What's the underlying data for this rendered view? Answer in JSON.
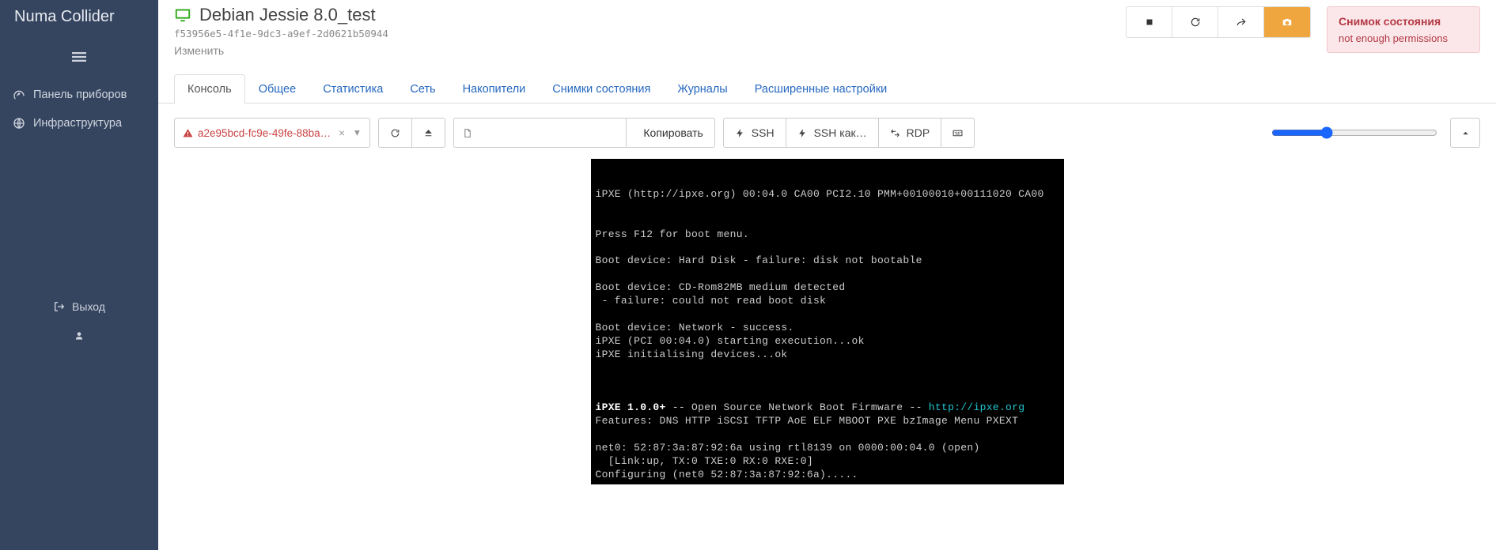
{
  "sidebar": {
    "brand": "Numa Collider",
    "items": [
      {
        "label": "Панель приборов"
      },
      {
        "label": "Инфраструктура"
      }
    ],
    "logout": "Выход"
  },
  "header": {
    "title": "Debian Jessie 8.0_test",
    "uuid": "f53956e5-4f1e-9dc3-a9ef-2d0621b50944",
    "edit": "Изменить"
  },
  "alert": {
    "title": "Снимок состояния",
    "body": "not enough permissions"
  },
  "tabs": [
    "Консоль",
    "Общее",
    "Статистика",
    "Сеть",
    "Накопители",
    "Снимки состояния",
    "Журналы",
    "Расширенные настройки"
  ],
  "active_tab_index": 0,
  "toolbar": {
    "iso_pill": "a2e95bcd-fc9e-49fe-88ba…",
    "copy_label": "Копировать",
    "ssh": "SSH",
    "ssh_as": "SSH как…",
    "rdp": "RDP"
  },
  "console_lines": [
    "",
    "iPXE (http://ipxe.org) 00:04.0 CA00 PCI2.10 PMM+00100010+00111020 CA00",
    "",
    "",
    "Press F12 for boot menu.",
    "",
    "Boot device: Hard Disk - failure: disk not bootable",
    "",
    "Boot device: CD-Rom82MB medium detected",
    " - failure: could not read boot disk",
    "",
    "Boot device: Network - success.",
    "iPXE (PCI 00:04.0) starting execution...ok",
    "iPXE initialising devices...ok",
    "",
    "",
    ""
  ],
  "console_bold_line": {
    "prefix": "iPXE 1.0.0+",
    "mid": " -- Open Source Network Boot Firmware -- ",
    "link": "http://ipxe.org"
  },
  "console_tail": [
    "Features: DNS HTTP iSCSI TFTP AoE ELF MBOOT PXE bzImage Menu PXEXT",
    "",
    "net0: 52:87:3a:87:92:6a using rtl8139 on 0000:00:04.0 (open)",
    "  [Link:up, TX:0 TXE:0 RX:0 RXE:0]",
    "Configuring (net0 52:87:3a:87:92:6a)....."
  ]
}
